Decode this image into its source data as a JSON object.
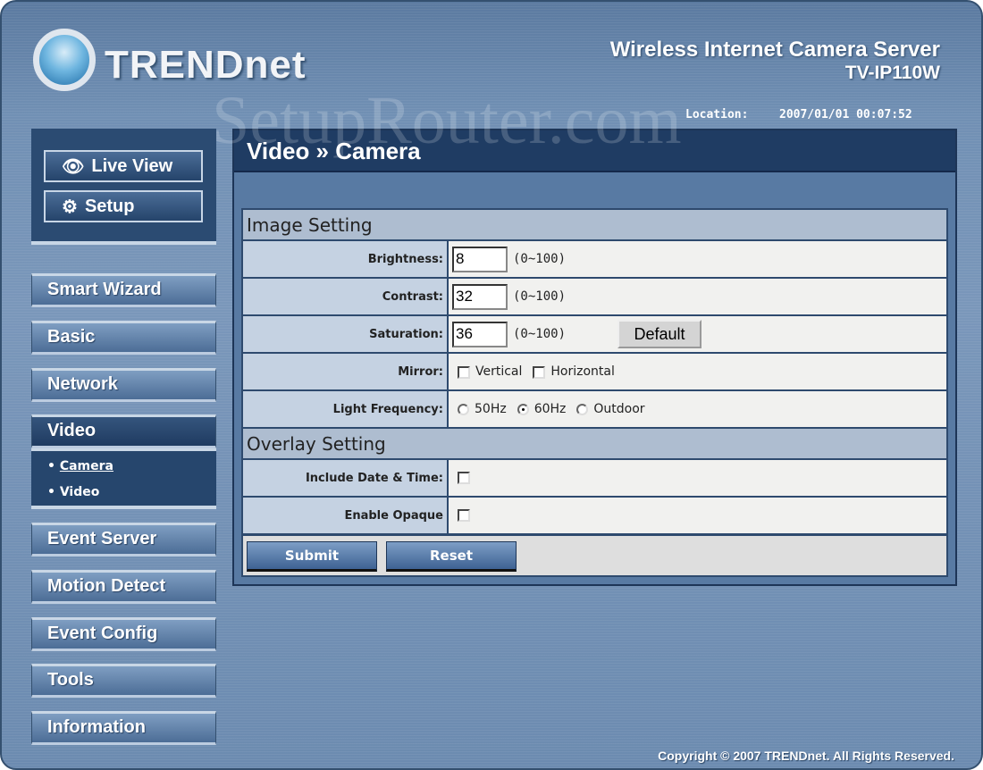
{
  "brand": {
    "logo_text": "TRENDnet",
    "product_name": "Wireless Internet Camera Server",
    "model": "TV-IP110W"
  },
  "location": {
    "label": "Location:",
    "datetime": "2007/01/01 00:07:52"
  },
  "watermark": "SetupRouter.com",
  "quick": {
    "live_view": "Live View",
    "setup": "Setup"
  },
  "menu": [
    "Smart Wizard",
    "Basic",
    "Network",
    "Video",
    "Event Server",
    "Motion Detect",
    "Event Config",
    "Tools",
    "Information"
  ],
  "submenu": [
    "Camera",
    "Video"
  ],
  "page_title": "Video » Camera",
  "image_setting": {
    "title": "Image Setting",
    "brightness": {
      "label": "Brightness:",
      "value": "8",
      "range": "(0~100)"
    },
    "contrast": {
      "label": "Contrast:",
      "value": "32",
      "range": "(0~100)"
    },
    "saturation": {
      "label": "Saturation:",
      "value": "36",
      "range": "(0~100)"
    },
    "default_button": "Default",
    "mirror": {
      "label": "Mirror:",
      "vertical": "Vertical",
      "horizontal": "Horizontal",
      "vertical_checked": false,
      "horizontal_checked": false
    },
    "light_frequency": {
      "label": "Light Frequency:",
      "options": [
        "50Hz",
        "60Hz",
        "Outdoor"
      ],
      "selected": "60Hz"
    }
  },
  "overlay_setting": {
    "title": "Overlay Setting",
    "include_date_time": {
      "label": "Include Date & Time:",
      "checked": false
    },
    "enable_opaque": {
      "label": "Enable Opaque",
      "checked": false
    }
  },
  "buttons": {
    "submit": "Submit",
    "reset": "Reset"
  },
  "copyright": "Copyright © 2007 TRENDnet. All Rights Reserved."
}
